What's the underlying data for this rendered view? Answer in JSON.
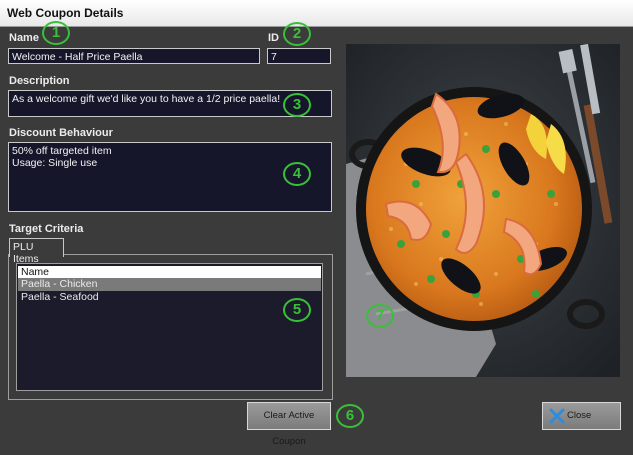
{
  "window": {
    "title": "Web Coupon Details"
  },
  "name": {
    "label": "Name",
    "value": "Welcome - Half Price Paella"
  },
  "id": {
    "label": "ID",
    "value": "7"
  },
  "description": {
    "label": "Description",
    "value": "As a welcome gift we'd like you to have a 1/2 price paella!"
  },
  "discount": {
    "label": "Discount Behaviour",
    "value": "50% off targeted item\nUsage: Single use"
  },
  "target": {
    "label": "Target Criteria",
    "tab_label": "PLU Items",
    "list_header": "Name",
    "items": [
      "Paella - Chicken",
      "Paella - Seafood"
    ]
  },
  "buttons": {
    "clear_label": "Clear Active Coupon",
    "close_label": "Close"
  },
  "callouts": [
    "1",
    "2",
    "3",
    "4",
    "5",
    "6",
    "7"
  ],
  "colors": {
    "callout": "#39c039",
    "field_bg": "#16162a",
    "window_bg": "#3b3b3b"
  }
}
